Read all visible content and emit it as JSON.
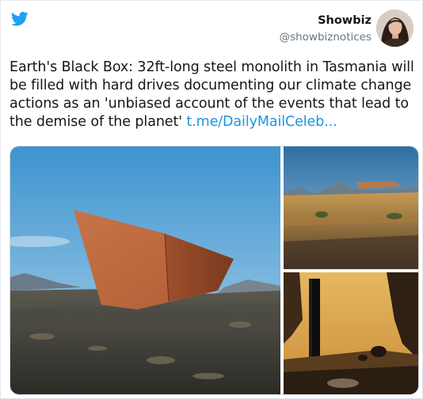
{
  "tweet": {
    "author_name": "Showbiz",
    "author_handle": "@showbiznotices",
    "text_body": "Earth's Black Box: 32ft-long steel monolith in Tasmania will be filled with hard drives documenting our climate change actions as an 'unbiased account of the events that lead to the demise of the planet'",
    "link_text": "t.me/DailyMailCeleb..."
  },
  "icons": {
    "brand": "twitter-bird-icon"
  },
  "colors": {
    "brand_blue": "#1da1f2",
    "link_blue": "#1b95e0",
    "handle_gray": "#657786"
  }
}
